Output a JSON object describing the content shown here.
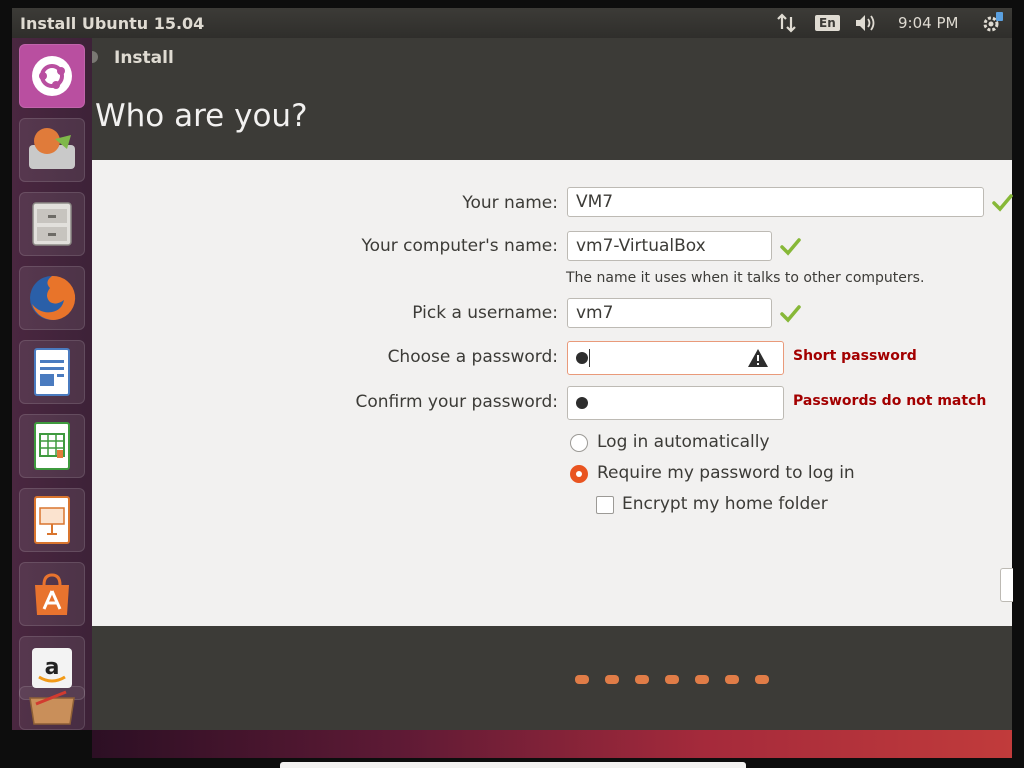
{
  "top_panel": {
    "title": "Install Ubuntu 15.04",
    "keyboard_layout": "En",
    "time": "9:04 PM"
  },
  "window": {
    "title": "Install",
    "page_title": "Who are you?"
  },
  "form": {
    "your_name": {
      "label": "Your name:",
      "value": "VM7"
    },
    "computer_name": {
      "label": "Your computer's name:",
      "value": "vm7-VirtualBox",
      "hint": "The name it uses when it talks to other computers."
    },
    "username": {
      "label": "Pick a username:",
      "value": "vm7"
    },
    "password": {
      "label": "Choose a password:",
      "error": "Short password"
    },
    "confirm_password": {
      "label": "Confirm your password:",
      "error": "Passwords do not match"
    },
    "login_auto": {
      "label": "Log in automatically",
      "selected": false
    },
    "login_require": {
      "label": "Require my password to log in",
      "selected": true
    },
    "encrypt_home": {
      "label": "Encrypt my home folder",
      "checked": false
    }
  },
  "progress": {
    "total_steps": 7
  },
  "colors": {
    "accent": "#e95420",
    "check": "#87b838",
    "error": "#a30000",
    "panel": "#3c3b37",
    "launcher": "#4a2740"
  },
  "launcher_icons": [
    "ubuntu-dash-icon",
    "ubuntu-installer-icon",
    "files-icon",
    "firefox-icon",
    "writer-icon",
    "calc-icon",
    "impress-icon",
    "software-center-icon",
    "amazon-icon",
    "trash-icon"
  ]
}
